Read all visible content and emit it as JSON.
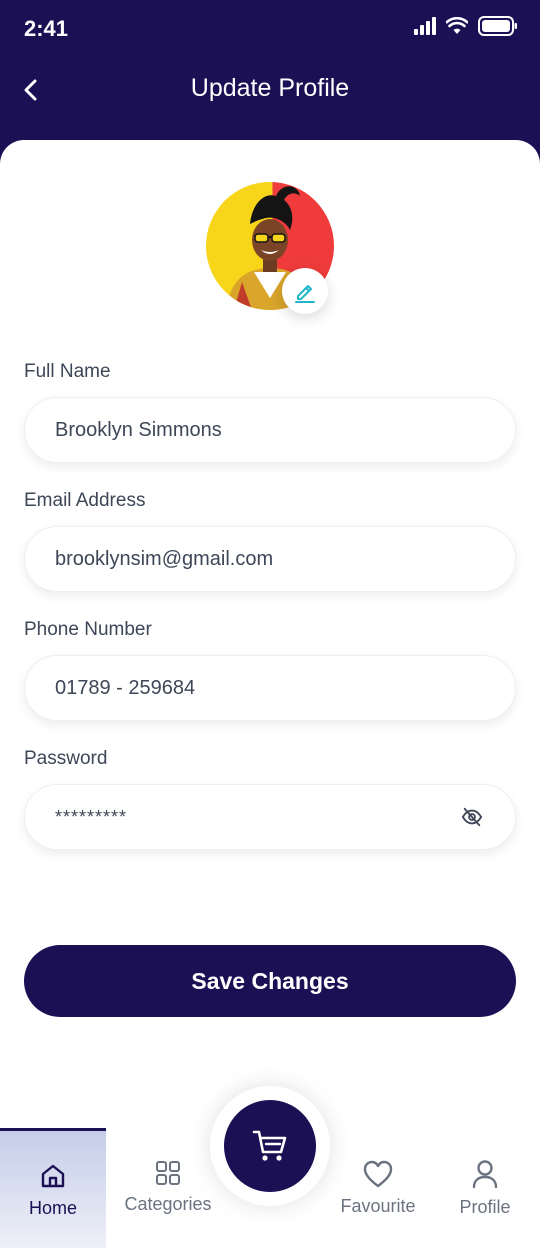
{
  "status_bar": {
    "time": "2:41"
  },
  "header": {
    "title": "Update Profile"
  },
  "form": {
    "full_name_label": "Full Name",
    "full_name_value": "Brooklyn Simmons",
    "email_label": "Email Address",
    "email_value": "brooklynsim@gmail.com",
    "phone_label": "Phone Number",
    "phone_value": "01789 - 259684",
    "password_label": "Password",
    "password_value": "*********"
  },
  "save_label": "Save Changes",
  "nav": {
    "items": [
      {
        "label": "Home",
        "icon": "home-icon",
        "active": true
      },
      {
        "label": "Categories",
        "icon": "grid-icon"
      },
      {
        "label": "Favourite",
        "icon": "heart-icon"
      },
      {
        "label": "Profile",
        "icon": "user-icon"
      }
    ],
    "center_icon": "cart-icon"
  },
  "colors": {
    "primary": "#1b1054",
    "accent": "#1fb6c9",
    "text": "#3d4757"
  }
}
